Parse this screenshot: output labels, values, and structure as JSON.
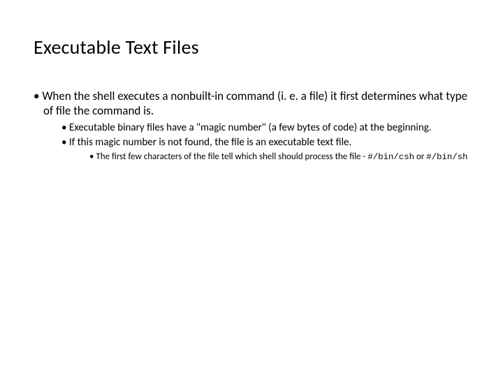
{
  "slide": {
    "title": "Executable Text Files",
    "bullet1": "When the shell executes a nonbuilt-in command (i. e. a file) it first determines what type of file the command is.",
    "sub1": "Executable binary files have a \"magic number\" (a few bytes of code) at the beginning.",
    "sub2": "If this magic number is not found, the file is an executable text file.",
    "subsub_pre": "The first few characters of the file tell which shell should process the file - ",
    "code1": "#/bin/csh",
    "subsub_mid": " or ",
    "code2": "#/bin/sh"
  }
}
